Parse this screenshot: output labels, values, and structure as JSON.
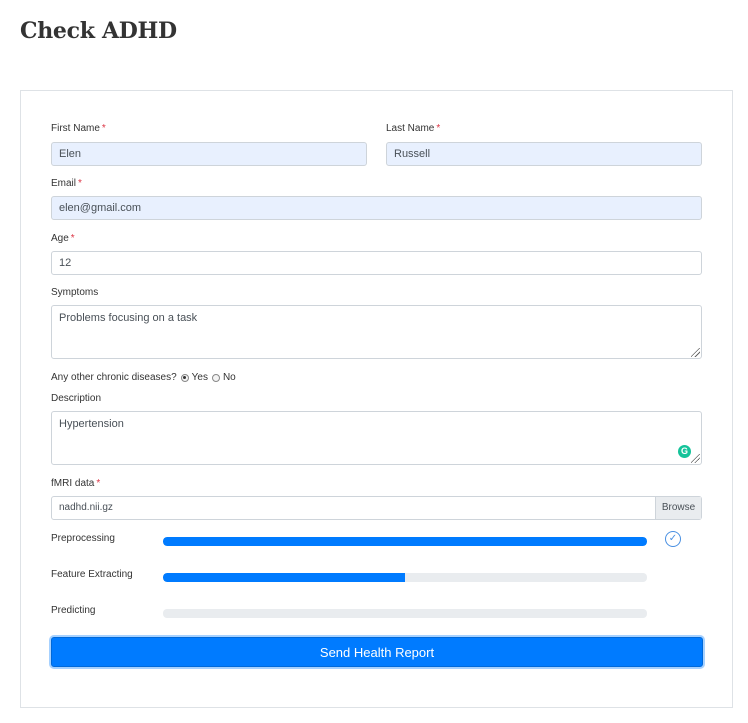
{
  "page": {
    "title": "Check ADHD"
  },
  "form": {
    "first_name": {
      "label": "First Name",
      "required": "*",
      "value": "Elen"
    },
    "last_name": {
      "label": "Last Name",
      "required": "*",
      "value": "Russell"
    },
    "email": {
      "label": "Email",
      "required": "*",
      "value": "elen@gmail.com"
    },
    "age": {
      "label": "Age",
      "required": "*",
      "value": "12"
    },
    "symptoms": {
      "label": "Symptoms",
      "value": "Problems focusing on a task"
    },
    "chronic": {
      "question": "Any other chronic diseases?",
      "yes_label": "Yes",
      "no_label": "No",
      "selected": "Yes"
    },
    "description": {
      "label": "Description",
      "value": "Hypertension"
    },
    "fmri": {
      "label": "fMRI data",
      "required": "*",
      "file_name": "nadhd.nii.gz",
      "browse_label": "Browse"
    },
    "progress": [
      {
        "label": "Preprocessing",
        "percent": 100,
        "status": "complete",
        "status_icon": "check-circle-icon"
      },
      {
        "label": "Feature Extracting",
        "percent": 50
      },
      {
        "label": "Predicting",
        "percent": 0
      }
    ],
    "submit_label": "Send Health Report"
  },
  "colors": {
    "accent": "#007bff",
    "track": "#e9ecef",
    "required": "#dc3545",
    "autofill": "#e8f0fe",
    "grammarly": "#15c39a"
  }
}
